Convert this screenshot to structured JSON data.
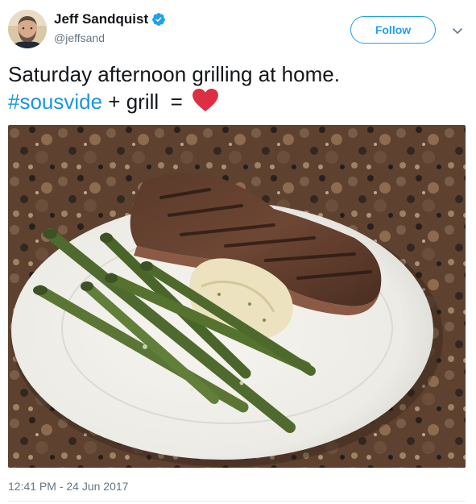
{
  "user": {
    "display_name": "Jeff Sandquist",
    "handle": "@jeffsand",
    "verified": true
  },
  "header": {
    "follow_label": "Follow",
    "menu_icon": "chevron-down-icon"
  },
  "tweet": {
    "line1": "Saturday afternoon grilling at home.",
    "hashtag": "#sousvide",
    "after_hashtag": " + grill  = ",
    "emoji": "heart-emoji",
    "timestamp": "12:41 PM - 24 Jun 2017"
  },
  "colors": {
    "accent": "#1da1f2",
    "hashtag": "#1b95e0",
    "text": "#14171a",
    "muted": "#657786",
    "heart": "#e0245e"
  }
}
